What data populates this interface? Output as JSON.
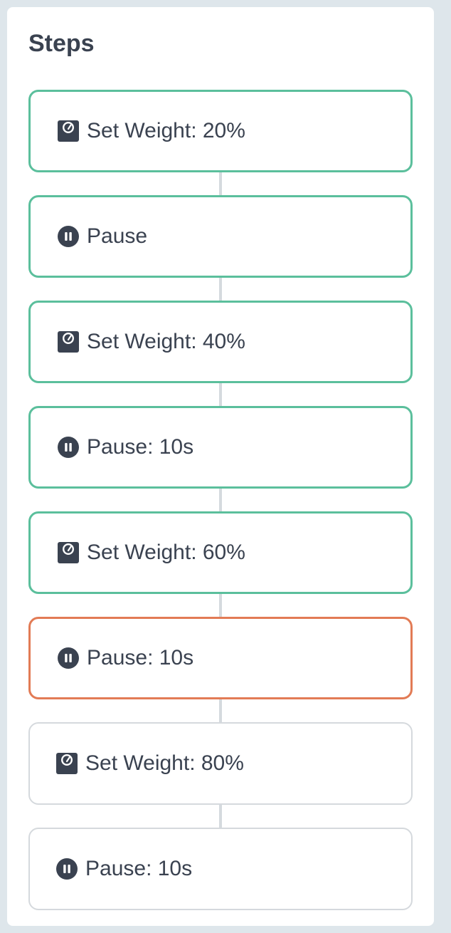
{
  "panel": {
    "title": "Steps"
  },
  "steps": [
    {
      "label": "Set Weight: 20%",
      "icon": "weight-scale-icon",
      "state": "completed"
    },
    {
      "label": "Pause",
      "icon": "pause-circle-icon",
      "state": "completed"
    },
    {
      "label": "Set Weight: 40%",
      "icon": "weight-scale-icon",
      "state": "completed"
    },
    {
      "label": "Pause: 10s",
      "icon": "pause-circle-icon",
      "state": "completed"
    },
    {
      "label": "Set Weight: 60%",
      "icon": "weight-scale-icon",
      "state": "completed"
    },
    {
      "label": "Pause: 10s",
      "icon": "pause-circle-icon",
      "state": "active"
    },
    {
      "label": "Set Weight: 80%",
      "icon": "weight-scale-icon",
      "state": "pending"
    },
    {
      "label": "Pause: 10s",
      "icon": "pause-circle-icon",
      "state": "pending"
    }
  ],
  "colors": {
    "completed": "#5bbf9c",
    "active": "#e27b55",
    "pending": "#d5d9dd",
    "text": "#3a4250"
  }
}
